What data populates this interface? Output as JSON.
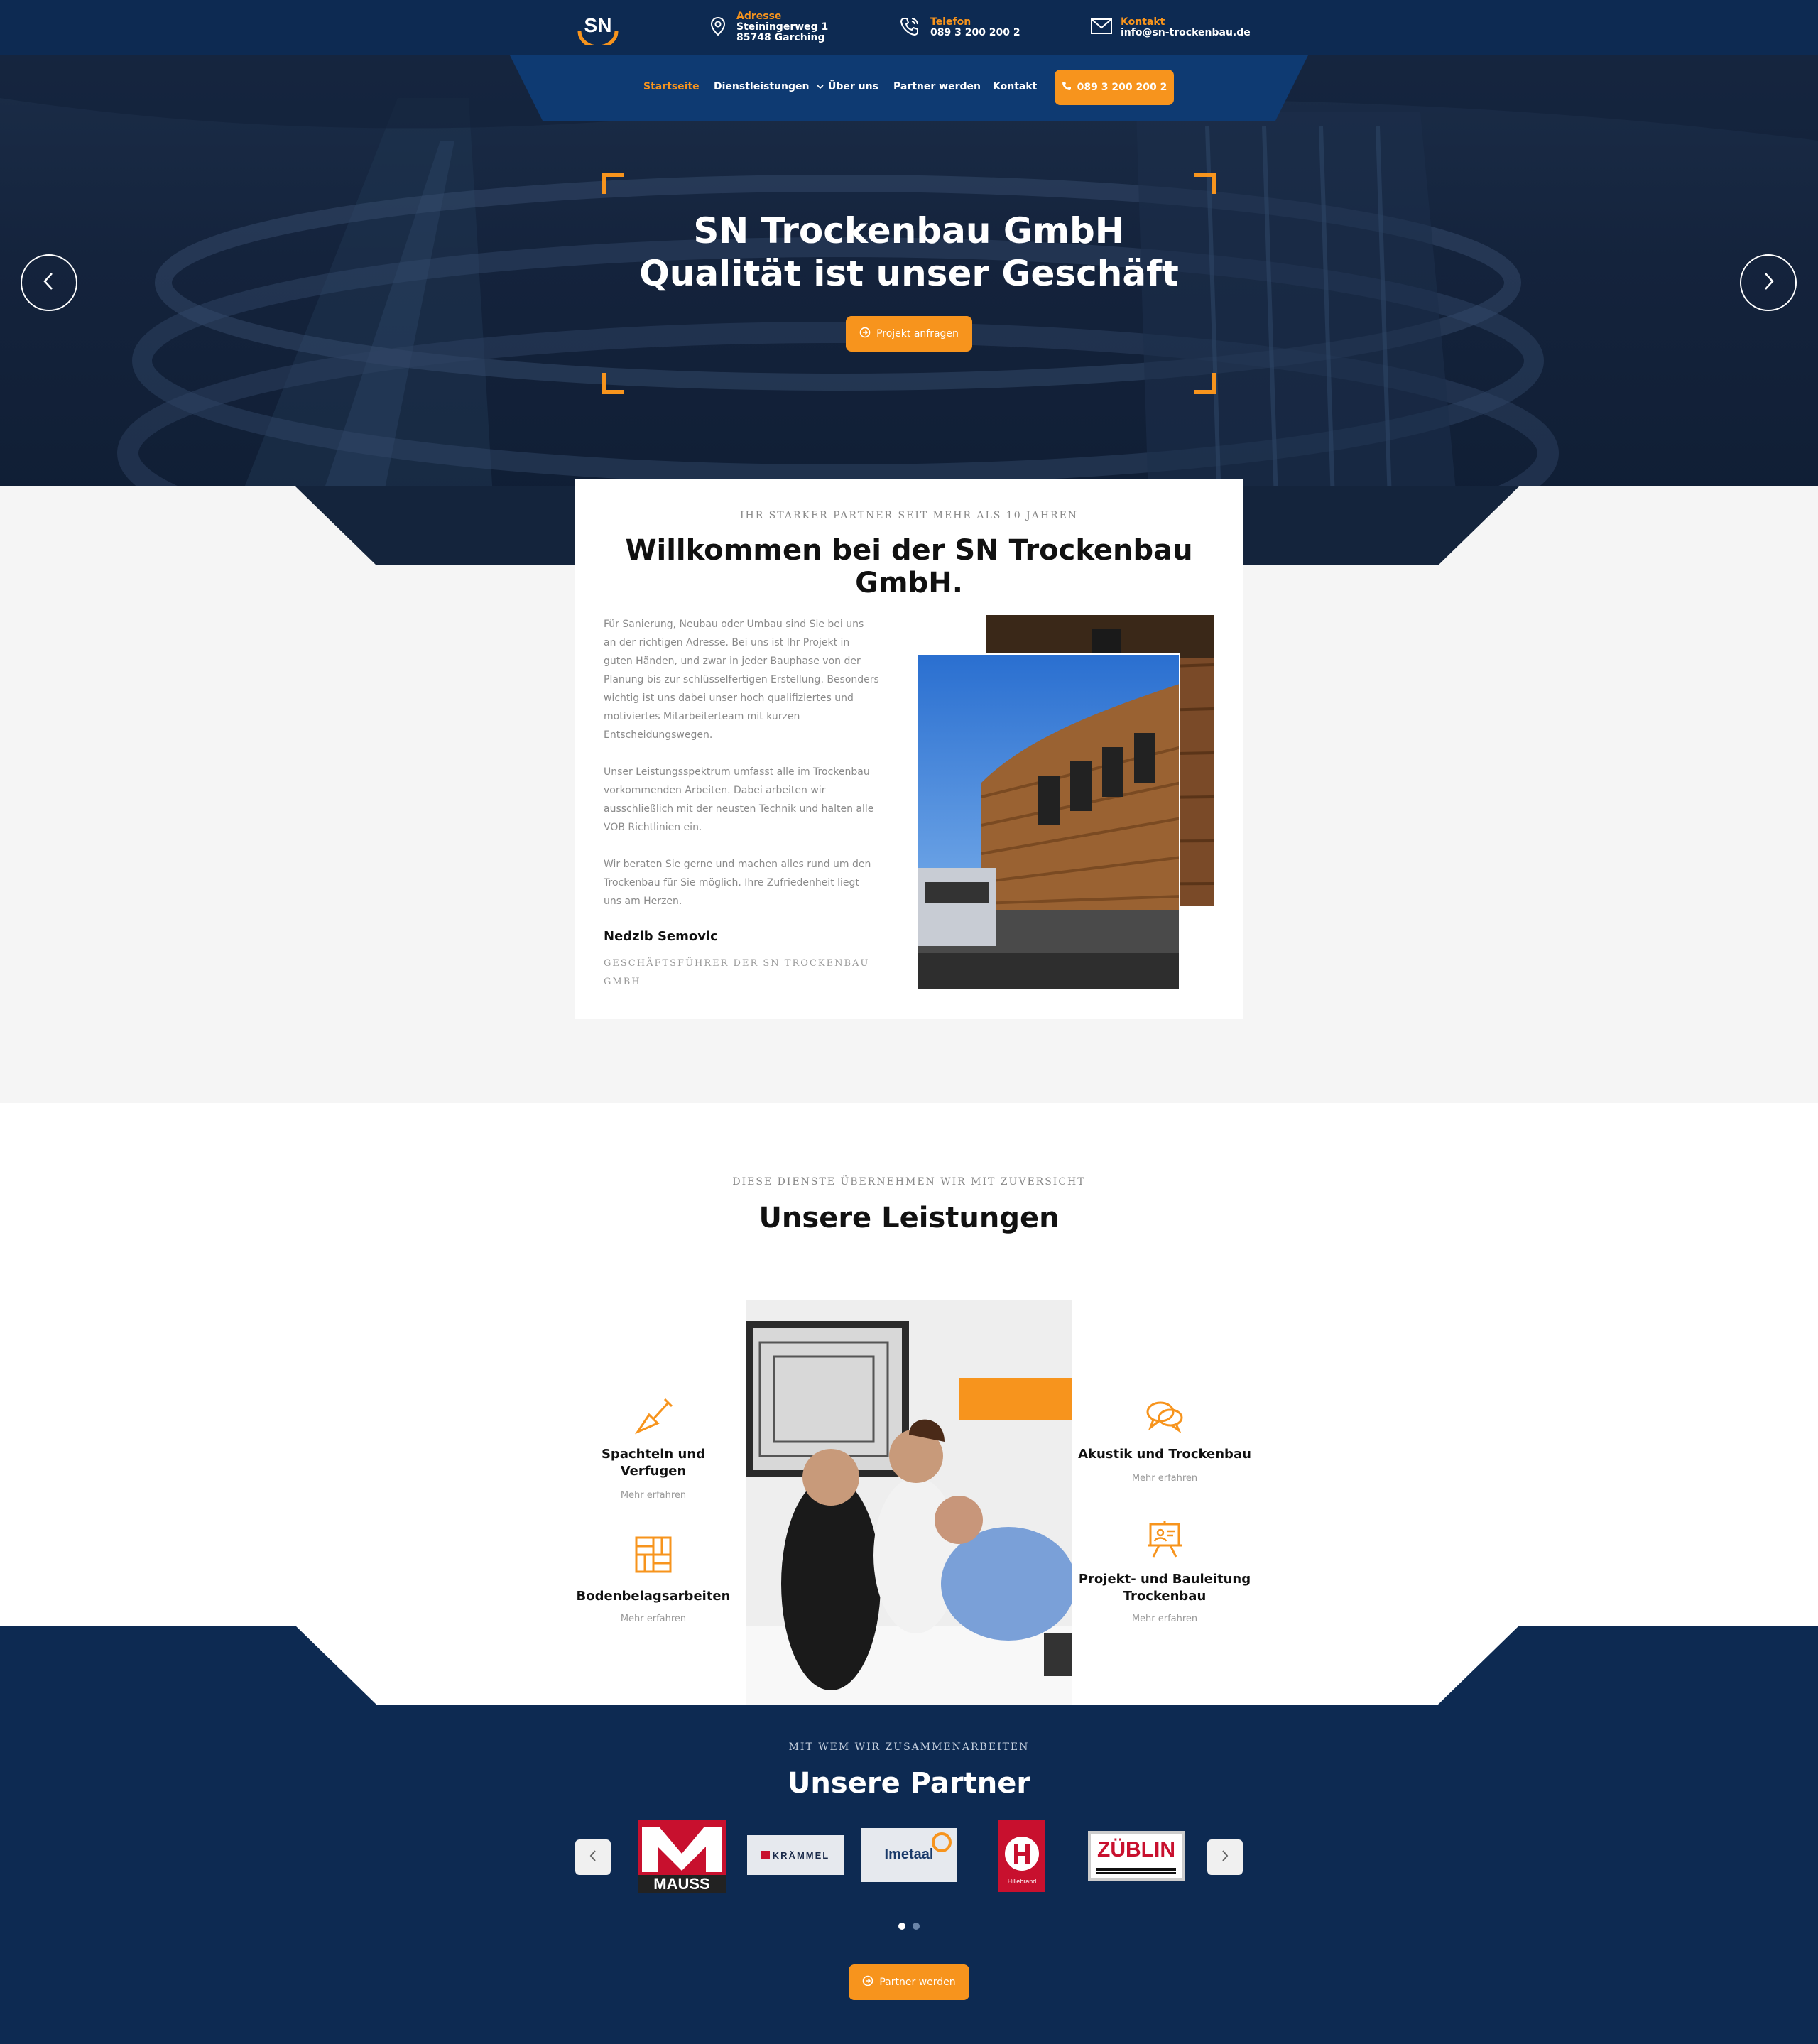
{
  "topbar": {
    "logo_text": "SN",
    "address": {
      "label": "Adresse",
      "line1": "Steiningerweg 1",
      "line2": "85748 Garching"
    },
    "phone": {
      "label": "Telefon",
      "value": "089 3 200 200 2"
    },
    "contact": {
      "label": "Kontakt",
      "value": "info@sn-trockenbau.de"
    }
  },
  "nav": {
    "items": [
      "Startseite",
      "Dienstleistungen",
      "Über uns",
      "Partner werden",
      "Kontakt"
    ],
    "phone_button": "089 3 200 200 2"
  },
  "hero": {
    "title_line1": "SN Trockenbau GmbH",
    "title_line2": "Qualität ist unser Geschäft",
    "button": "Projekt anfragen"
  },
  "welcome": {
    "eyebrow": "Ihr starker Partner seit mehr als 10 Jahren",
    "title": "Willkommen bei der SN Trockenbau GmbH.",
    "paragraphs": [
      "Für Sanierung, Neubau oder Umbau sind Sie bei uns an der richtigen Adresse. Bei uns ist Ihr Projekt in guten Händen, und zwar in jeder Bauphase von der Planung bis zur schlüsselfertigen Erstellung. Besonders wichtig ist uns dabei unser hoch qualifiziertes und motiviertes Mitarbeiterteam mit kurzen Entscheidungswegen.",
      "Unser Leistungsspektrum umfasst alle im Trockenbau vorkommenden Arbeiten. Dabei arbeiten wir ausschließlich mit der neusten Technik und halten alle VOB Richtlinien ein.",
      "Wir beraten Sie gerne und machen alles rund um den Trockenbau für Sie möglich. Ihre Zufriedenheit liegt uns am Herzen."
    ],
    "signature_name": "Nedzib Semovic",
    "signature_role": "Geschäftsführer der SN Trockenbau GmbH"
  },
  "services": {
    "eyebrow": "Diese Dienste übernehmen wir mit Zuversicht",
    "title": "Unsere Leistungen",
    "items": [
      {
        "title_line1": "Spachteln und",
        "title_line2": "Verfugen",
        "link": "Mehr erfahren",
        "icon": "trowel-icon"
      },
      {
        "title_line1": "Bodenbelagsarbeiten",
        "title_line2": "",
        "link": "Mehr erfahren",
        "icon": "floor-tiles-icon"
      },
      {
        "title_line1": "Akustik und Trockenbau",
        "title_line2": "",
        "link": "Mehr erfahren",
        "icon": "speech-bubbles-icon"
      },
      {
        "title_line1": "Projekt- und Bauleitung",
        "title_line2": "Trockenbau",
        "link": "Mehr erfahren",
        "icon": "presentation-board-icon"
      }
    ]
  },
  "partners": {
    "eyebrow": "Mit wem wir zusammenarbeiten",
    "title": "Unsere Partner",
    "logos": [
      "MAUSS",
      "KRÄMMEL",
      "Imetaal",
      "Hillebrand",
      "ZÜBLIN"
    ],
    "button": "Partner werden"
  },
  "colors": {
    "accent": "#f7941d",
    "navy": "#0d2a52",
    "light_bg": "#f5f5f5"
  }
}
